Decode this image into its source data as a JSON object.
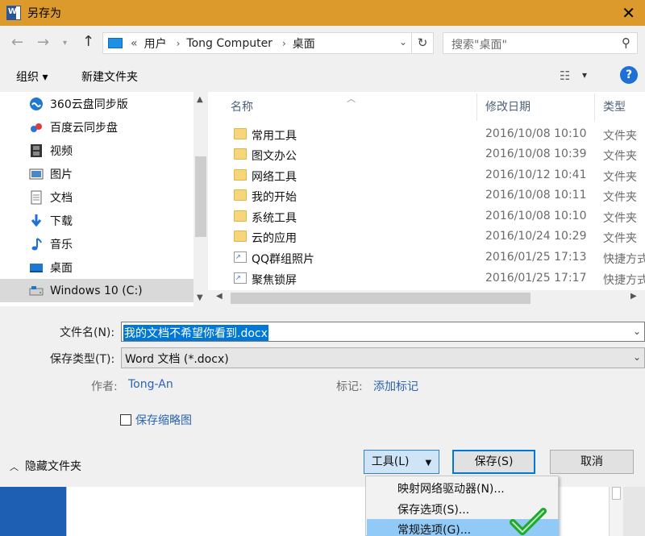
{
  "window": {
    "title": "另存为"
  },
  "address": {
    "crumbs": [
      "«",
      "用户",
      "Tong Computer",
      "桌面"
    ],
    "search_placeholder": "搜索\"桌面\""
  },
  "toolbar": {
    "organize": "组织 ▾",
    "new_folder": "新建文件夹"
  },
  "nav": {
    "items": [
      {
        "label": "360云盘同步版",
        "icon": "cloud-sync-icon"
      },
      {
        "label": "百度云同步盘",
        "icon": "baidu-cloud-icon"
      },
      {
        "label": "视频",
        "icon": "video-icon"
      },
      {
        "label": "图片",
        "icon": "pictures-icon"
      },
      {
        "label": "文档",
        "icon": "documents-icon"
      },
      {
        "label": "下载",
        "icon": "download-icon"
      },
      {
        "label": "音乐",
        "icon": "music-icon"
      },
      {
        "label": "桌面",
        "icon": "desktop-icon"
      },
      {
        "label": "Windows 10 (C:)",
        "icon": "drive-icon"
      }
    ],
    "selected_index": 8
  },
  "files": {
    "columns": [
      "名称",
      "修改日期",
      "类型"
    ],
    "rows": [
      {
        "name": "常用工具",
        "date": "2016/10/08 10:10",
        "type": "文件夹",
        "kind": "folder"
      },
      {
        "name": "图文办公",
        "date": "2016/10/08 10:39",
        "type": "文件夹",
        "kind": "folder"
      },
      {
        "name": "网络工具",
        "date": "2016/10/12 10:41",
        "type": "文件夹",
        "kind": "folder"
      },
      {
        "name": "我的开始",
        "date": "2016/10/08 10:11",
        "type": "文件夹",
        "kind": "folder"
      },
      {
        "name": "系统工具",
        "date": "2016/10/08 10:10",
        "type": "文件夹",
        "kind": "folder"
      },
      {
        "name": "云的应用",
        "date": "2016/10/24 10:29",
        "type": "文件夹",
        "kind": "folder"
      },
      {
        "name": "QQ群组照片",
        "date": "2016/01/25 17:13",
        "type": "快捷方式",
        "kind": "shortcut"
      },
      {
        "name": "聚焦锁屏",
        "date": "2016/01/25 17:17",
        "type": "快捷方式",
        "kind": "shortcut"
      }
    ]
  },
  "form": {
    "filename_label": "文件名(N):",
    "filename_value": "我的文档不希望你看到.docx",
    "filetype_label": "保存类型(T):",
    "filetype_value": "Word 文档 (*.docx)",
    "author_key": "作者:",
    "author_value": "Tong-An",
    "tags_key": "标记:",
    "tags_value": "添加标记",
    "thumbnail_label": "保存缩略图",
    "hide_folders": "隐藏文件夹",
    "tools_button": "工具(L)",
    "save_button": "保存(S)",
    "cancel_button": "取消"
  },
  "tools_menu": {
    "items": [
      "映射网络驱动器(N)...",
      "保存选项(S)...",
      "常规选项(G)..."
    ],
    "highlighted_index": 2
  }
}
